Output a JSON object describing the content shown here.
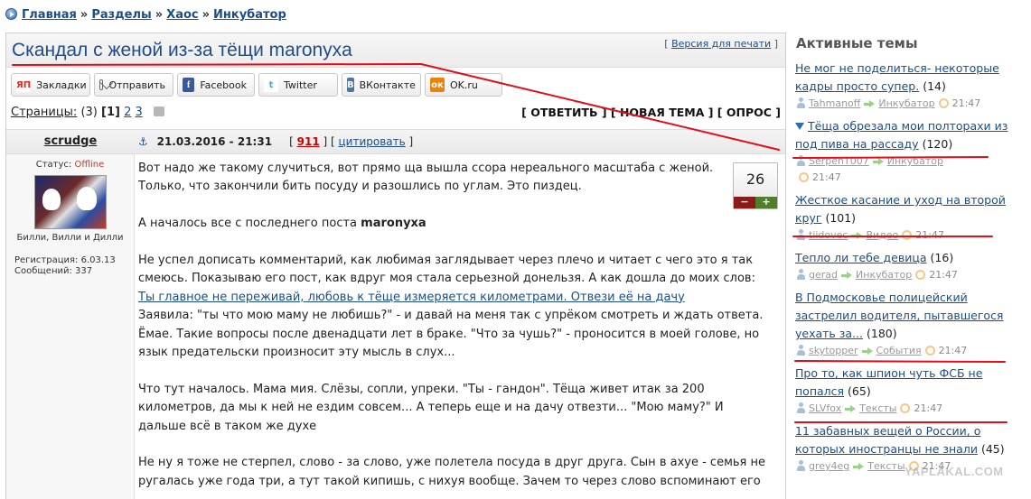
{
  "breadcrumb": {
    "items": [
      "Главная",
      "Разделы",
      "Хаос",
      "Инкубатор"
    ],
    "separator": "»"
  },
  "topic": {
    "title": "Скандал с женой из-за тёщи maronyxa",
    "print_link": "Версия для печати"
  },
  "share": [
    {
      "icon": "yandex-icon",
      "glyph": "ЯП",
      "label": "Закладки"
    },
    {
      "icon": "mail-icon",
      "glyph": "",
      "label": "Отправить"
    },
    {
      "icon": "facebook-icon",
      "glyph": "f",
      "label": "Facebook"
    },
    {
      "icon": "twitter-icon",
      "glyph": "t",
      "label": "Twitter"
    },
    {
      "icon": "vk-icon",
      "glyph": "В",
      "label": "ВКонтакте"
    },
    {
      "icon": "ok-icon",
      "glyph": "ок",
      "label": "OK.ru"
    }
  ],
  "pagination": {
    "label": "Страницы:",
    "total": "(3)",
    "current": "[1]",
    "pages": [
      "2",
      "3"
    ],
    "actions": "[ ОТВЕТИТЬ ] [ НОВАЯ ТЕМА ] [ ОПРОС ]"
  },
  "post": {
    "author": "scrudge",
    "status_label": "Статус:",
    "status_value": "Offline",
    "nick_caption": "Билли, Вилли и Дилли",
    "registration": "Регистрация: 6.03.13",
    "messages": "Сообщений: 337",
    "anchor_glyph": "⚓",
    "date": "21.03.2016 - 21:31",
    "number": "911",
    "quote": "цитировать",
    "rating": "26",
    "rating_minus": "−",
    "rating_plus": "+",
    "p1": "Вот надо же такому случиться, вот прямо ща вышла ссора нереального масштаба с женой. Только, что закончили бить посуду и разошлись по углам. Это пиздец.",
    "p2_prefix": "А началось все с последнего поста ",
    "p2_user": "maronyxa",
    "p3": "Не успел дописать комментарий, как любимая заглядывает через плечо и читает с чего это я так смеюсь. Показываю его пост, как вдруг моя стала серьезной донельзя. А как дошла до моих слов:",
    "p3_link": "Ты главное не переживай, любовь к тёще измеряется километрами. Отвези её на дачу",
    "p4": "Заявила: \"ты что мою маму не любишь?\" - и давай на меня так с упрёком смотреть и ждать ответа. Ёмае. Такие вопросы после двенадцати лет в браке. \"Что за чушь?\" - проносится в моей голове, но язык предательски произносит эту мысль в слух...",
    "p5": "Что тут началось. Мама мия. Слёзы, сопли, упреки. \"Ты - гандон\". Тёща живет итак за 200 километров, да мы к ней не ездим совсем... А теперь еще и на дачу отвезти... \"Мою маму?\" И дальше всё в таком же духе",
    "p6": "Не ну я тоже не стерпел, слово - за слово, уже полетела посуда в друг друга. Сын в ахуе - семья не ругалась уже года три, а тут такой кипишь, с нихуя вообще. Зачем то через слово вспоминают его"
  },
  "sidebar": {
    "title": "Активные темы",
    "topics": [
      {
        "title": "Не мог не поделиться- некоторые кадры просто супер.",
        "count": "(14)",
        "user": "Tahmanoff",
        "section": "Инкубатор",
        "time": "21:47",
        "new": false
      },
      {
        "title": "Тёща обрезала мои полторахи из под пива на рассаду",
        "count": "(120)",
        "user": "SerpenT007",
        "section": "Инкубатор",
        "time": "21:47",
        "new": true
      },
      {
        "title": "Жесткое касание и уход на второй круг",
        "count": "(101)",
        "user": "tiidovec",
        "section": "Видео",
        "time": "21:47",
        "new": false
      },
      {
        "title": "Тепло ли тебе девица",
        "count": "(16)",
        "user": "gerad",
        "section": "Инкубатор",
        "time": "21:47",
        "new": false
      },
      {
        "title": "В Подмосковье полицейский застрелил водителя, пытавшегося уехать за...",
        "count": "(180)",
        "user": "skytopper",
        "section": "События",
        "time": "21:47",
        "new": false
      },
      {
        "title": "Про то, как шпион чуть ФСБ не попался",
        "count": "(65)",
        "user": "SLVfox",
        "section": "Тексты",
        "time": "21:47",
        "new": false
      },
      {
        "title": "11 забавных вещей о России, о которых иностранцы не знали",
        "count": "(45)",
        "user": "grey4eg",
        "section": "Тексты",
        "time": "21:47",
        "new": false
      }
    ]
  },
  "watermark": "YAPLAKAL.COM",
  "colors": {
    "link": "#1a4e8a",
    "title": "#1f4d8c",
    "offline": "#c0392b",
    "post_number": "#cc0000",
    "annotation": "#e0101a"
  }
}
